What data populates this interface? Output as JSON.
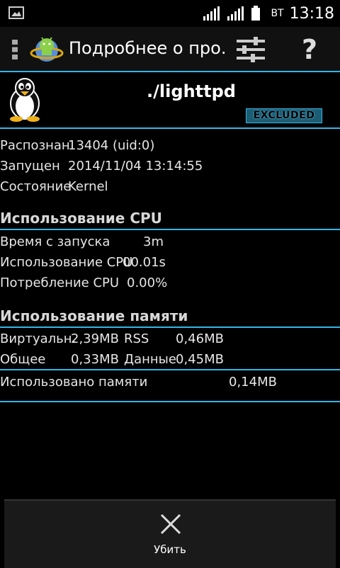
{
  "status_bar": {
    "day": "ВТ",
    "time": "13:18",
    "icons": [
      "image-icon",
      "signal-1-icon",
      "signal-2-icon",
      "battery-icon"
    ]
  },
  "action_bar": {
    "title": "Подробнее о про...",
    "icons": [
      "overflow-menu-icon",
      "app-icon",
      "filter-settings-icon",
      "help-icon"
    ],
    "help_label": "?"
  },
  "process": {
    "name": "./lighttpd",
    "badge": "EXCLUDED",
    "icon": "linux-penguin-icon"
  },
  "info": [
    {
      "label": "Распознан",
      "value": "13404 (uid:0)"
    },
    {
      "label": "Запущен",
      "value": "2014/11/04 13:14:55"
    },
    {
      "label": "Состояние",
      "value": "Kernel"
    }
  ],
  "cpu": {
    "title": "Использование CPU",
    "rows": [
      {
        "label": "Время с запуска",
        "value": "3m"
      },
      {
        "label": "Использование CPU",
        "value": "00.01s"
      },
      {
        "label": "Потребление CPU",
        "value": "0.00%"
      }
    ]
  },
  "memory": {
    "title": "Использование памяти",
    "virtual_label": "Виртуальн.",
    "virtual_value": "2,39MB",
    "rss_label": "RSS",
    "rss_value": "0,46MB",
    "shared_label": "Общее",
    "shared_value": "0,33MB",
    "data_label": "Данные",
    "data_value": "0,45MB",
    "used_label": "Использовано памяти",
    "used_value": "0,14MB"
  },
  "kill": {
    "label": "Убить",
    "icon": "close-icon"
  },
  "colors": {
    "accent": "#33b5e5",
    "background": "#000000",
    "actionbar": "#111111"
  }
}
